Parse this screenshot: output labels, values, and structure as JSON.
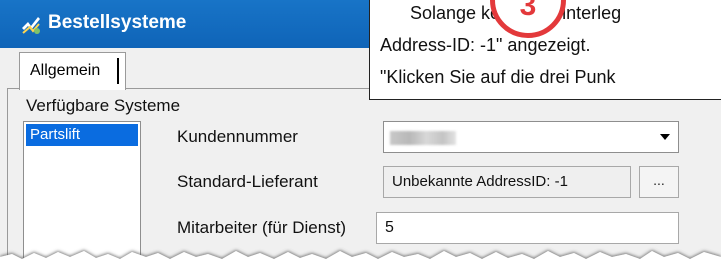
{
  "window": {
    "title": "Bestellsysteme",
    "accent_color": "#0f64b8"
  },
  "tabs": [
    {
      "label": "Allgemein",
      "selected": true
    }
  ],
  "systems": {
    "section_label": "Verfügbare Systeme",
    "items": [
      {
        "label": "Partslift",
        "selected": true
      }
    ]
  },
  "fields": {
    "customer_number": {
      "label": "Kundennummer",
      "value": ""
    },
    "default_supplier": {
      "label": "Standard-Lieferant",
      "value": "Unbekannte AddressID: -1",
      "button_label": "..."
    },
    "employee_service": {
      "label": "Mitarbeiter (für Dienst)",
      "value": "5"
    }
  },
  "annotation": {
    "step_number": "3",
    "badge_color": "#e3393b",
    "lines": [
      "Solange keine ID hinterleg",
      "Address-ID: -1\" angezeigt.",
      "\"Klicken Sie auf die drei Punk"
    ]
  }
}
